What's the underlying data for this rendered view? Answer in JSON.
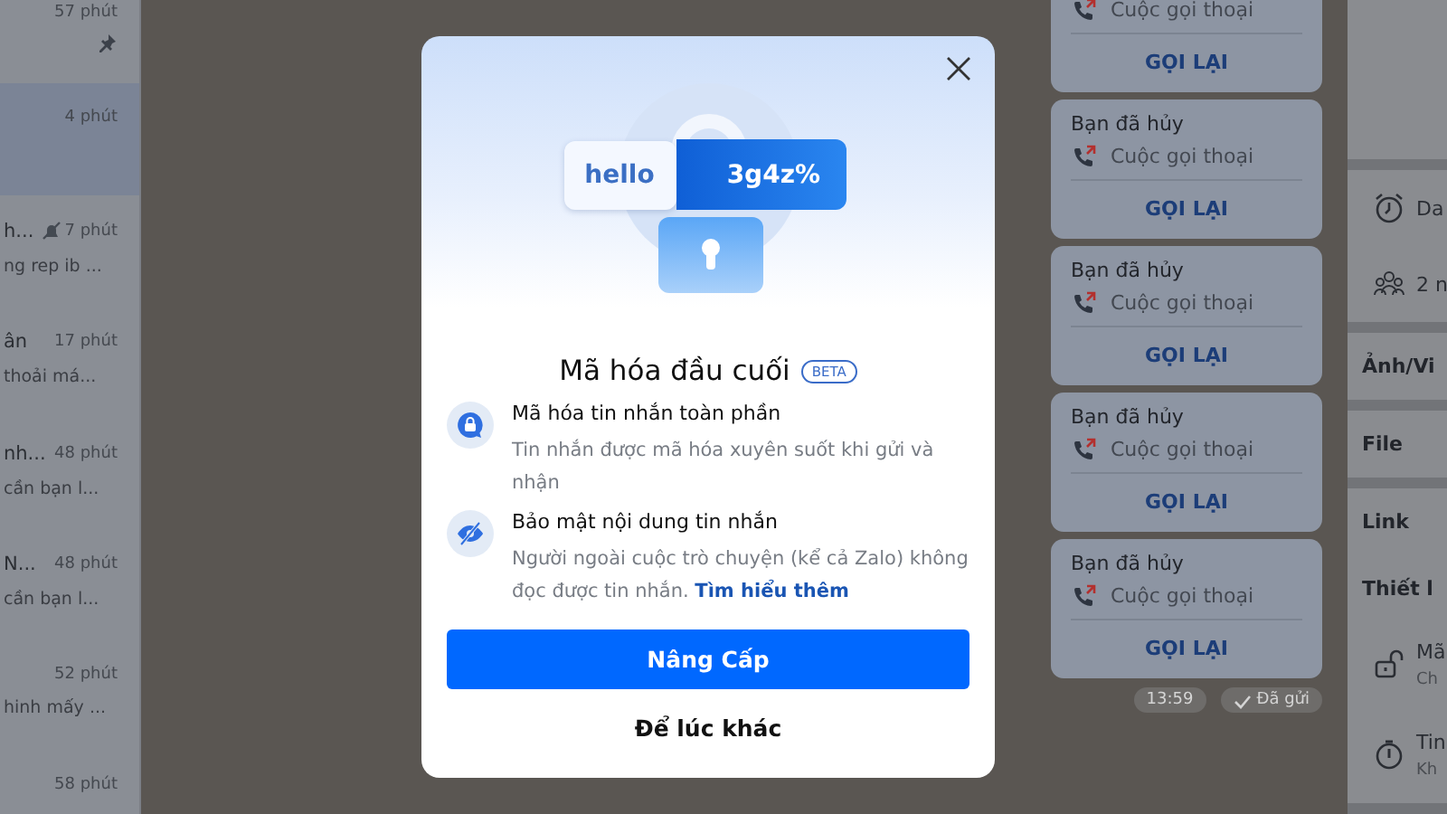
{
  "chat_list": {
    "items": [
      {
        "time": "57 phút",
        "pinned": true,
        "muted": false,
        "selected": false
      },
      {
        "time": "4 phút",
        "pinned": false,
        "muted": false,
        "selected": true
      },
      {
        "name": "h...",
        "time": "7 phút",
        "preview": "ng rep ib ...",
        "pinned": false,
        "muted": true,
        "selected": false
      },
      {
        "name": "ân",
        "time": "17 phút",
        "preview": "thoải má...",
        "pinned": false,
        "muted": false,
        "selected": false
      },
      {
        "name": "nh...",
        "time": "48 phút",
        "preview": "cần bạn l...",
        "pinned": false,
        "muted": false,
        "selected": false
      },
      {
        "name": "N...",
        "time": "48 phút",
        "preview": "cần bạn l...",
        "pinned": false,
        "muted": false,
        "selected": false
      },
      {
        "time": "52 phút",
        "preview": "hinh mấy ...",
        "pinned": false,
        "muted": false,
        "selected": false
      },
      {
        "time": "58 phút",
        "pinned": false,
        "muted": false,
        "selected": false
      }
    ]
  },
  "chat": {
    "call_cards": [
      {
        "call_type": "Cuộc gọi thoại",
        "action": "GỌI LẠI"
      },
      {
        "title": "Bạn đã hủy",
        "call_type": "Cuộc gọi thoại",
        "action": "GỌI LẠI"
      },
      {
        "title": "Bạn đã hủy",
        "call_type": "Cuộc gọi thoại",
        "action": "GỌI LẠI"
      },
      {
        "title": "Bạn đã hủy",
        "call_type": "Cuộc gọi thoại",
        "action": "GỌI LẠI"
      },
      {
        "title": "Bạn đã hủy",
        "call_type": "Cuộc gọi thoại",
        "action": "GỌI LẠI"
      }
    ],
    "time": "13:59",
    "status": "Đã gửi"
  },
  "info_panel": {
    "rows": [
      {
        "kind": "item",
        "text": "Da"
      },
      {
        "kind": "item",
        "text": "2 n"
      },
      {
        "kind": "section",
        "text": "Ảnh/Vi"
      },
      {
        "kind": "section",
        "text": "File"
      },
      {
        "kind": "section",
        "text": "Link"
      },
      {
        "kind": "section",
        "text": "Thiết l"
      },
      {
        "kind": "setting",
        "text": "Mã",
        "sub": "Ch"
      },
      {
        "kind": "setting",
        "text": "Tin",
        "sub": "Kh"
      }
    ]
  },
  "modal": {
    "illustration": {
      "plain_text": "hello",
      "cipher_text": "3g4z%"
    },
    "title": "Mã hóa đầu cuối",
    "badge": "BETA",
    "features": [
      {
        "title": "Mã hóa tin nhắn toàn phần",
        "description": "Tin nhắn được mã hóa xuyên suốt khi gửi và nhận"
      },
      {
        "title": "Bảo mật nội dung tin nhắn",
        "description": "Người ngoài cuộc trò chuyện (kể cả Zalo) không đọc được tin nhắn.",
        "link": "Tìm hiểu thêm"
      }
    ],
    "primary_button": "Nâng Cấp",
    "secondary_button": "Để lúc khác"
  }
}
